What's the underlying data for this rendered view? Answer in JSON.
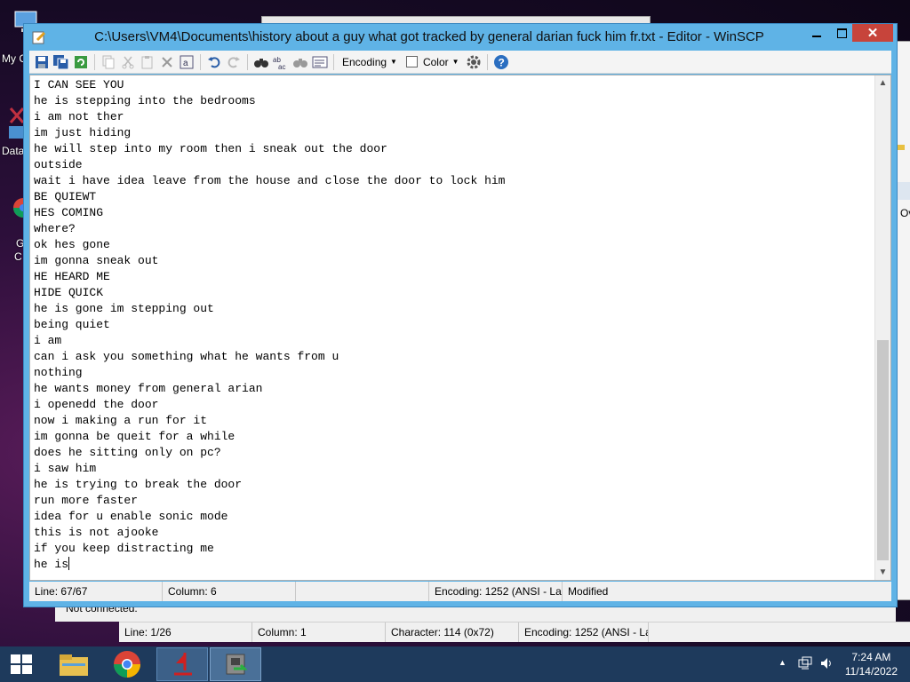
{
  "desktop": {
    "icons": [
      {
        "label": "My C"
      },
      {
        "label": "Data"
      },
      {
        "label": "G"
      },
      {
        "label": "C"
      }
    ]
  },
  "background_window": {
    "side_text": "Ov",
    "status_text": "Not connected.",
    "statusbar": {
      "line": "Line: 1/26",
      "column": "Column: 1",
      "character": "Character: 114 (0x72)",
      "encoding": "Encoding: 1252  (ANSI - La"
    }
  },
  "editor_window": {
    "title": "C:\\Users\\VM4\\Documents\\history about a guy what got tracked by general darian fuck him fr.txt - Editor - WinSCP",
    "toolbar": {
      "encoding_label": "Encoding",
      "color_label": "Color"
    },
    "lines": [
      "I CAN SEE YOU",
      "he is stepping into the bedrooms",
      "i am not ther",
      "im just hiding",
      "he will step into my room then i sneak out the door",
      "outside",
      "wait i have idea leave from the house and close the door to lock him",
      "BE QUIEWT",
      "HES COMING",
      "where?",
      "ok hes gone",
      "im gonna sneak out",
      "HE HEARD ME",
      "HIDE QUICK",
      "he is gone im stepping out",
      "being quiet",
      "i am",
      "can i ask you something what he wants from u",
      "nothing",
      "he wants money from general arian",
      "i openedd the door",
      "now i making a run for it",
      "im gonna be queit for a while",
      "does he sitting only on pc?",
      "i saw him",
      "he is trying to break the door",
      "run more faster",
      "idea for u enable sonic mode",
      "this is not ajooke",
      "if you keep distracting me",
      "he is"
    ],
    "statusbar": {
      "line": "Line: 67/67",
      "column": "Column: 6",
      "encoding": "Encoding: 1252  (ANSI - La",
      "modified": "Modified"
    }
  },
  "taskbar": {
    "time": "7:24 AM",
    "date": "11/14/2022"
  },
  "colors": {
    "title_bar": "#5fb3e6",
    "close_button": "#c7443b",
    "taskbar": "#1e3a5c"
  }
}
